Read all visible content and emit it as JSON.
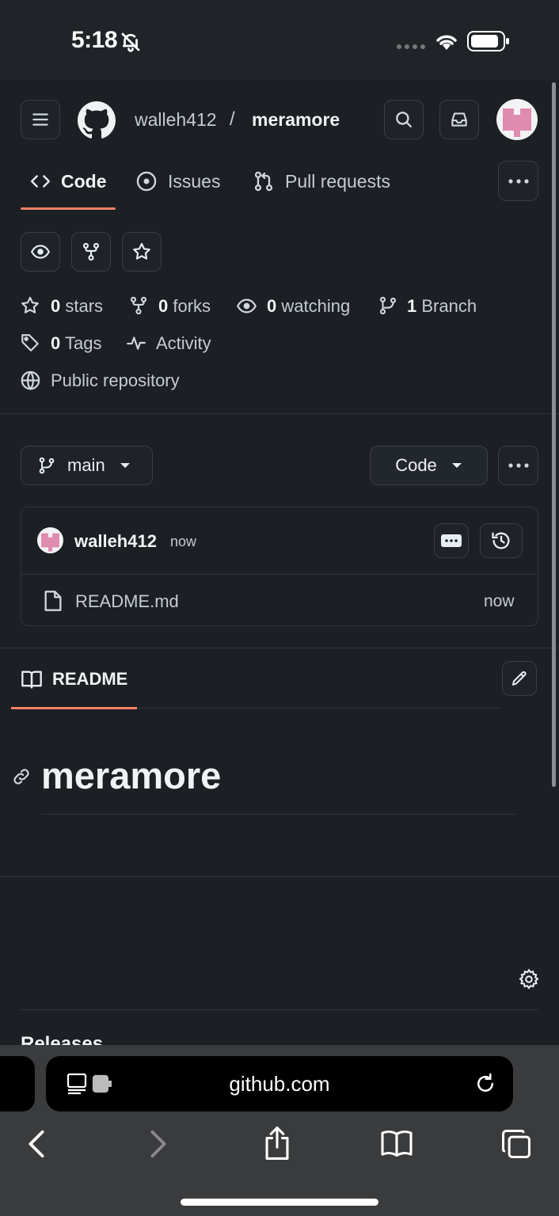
{
  "status_bar": {
    "time": "5:18"
  },
  "header": {
    "owner": "walleh412",
    "separator": "/",
    "repo": "meramore"
  },
  "nav": {
    "tabs": [
      {
        "label": "Code",
        "icon": "code-icon",
        "active": true
      },
      {
        "label": "Issues",
        "icon": "issue-opened-icon"
      },
      {
        "label": "Pull requests",
        "icon": "git-pull-request-icon"
      }
    ]
  },
  "stats": {
    "stars_count": "0",
    "stars_label": "stars",
    "forks_count": "0",
    "forks_label": "forks",
    "watching_count": "0",
    "watching_label": "watching",
    "branch_count": "1",
    "branch_label": "Branch",
    "tags_count": "0",
    "tags_label": "Tags",
    "activity_label": "Activity",
    "visibility_label": "Public repository"
  },
  "branch_bar": {
    "branch": "main",
    "code_button": "Code"
  },
  "latest_commit": {
    "author": "walleh412",
    "time": "now"
  },
  "files": [
    {
      "name": "README.md",
      "time": "now",
      "icon": "file-icon"
    }
  ],
  "readme": {
    "tab_label": "README",
    "heading": "meramore"
  },
  "releases": {
    "title": "Releases"
  },
  "browser": {
    "url": "github.com"
  },
  "colors": {
    "accent_underline": "#f78166",
    "background": "#1c1f23",
    "avatar_pink": "#e08bb0"
  }
}
